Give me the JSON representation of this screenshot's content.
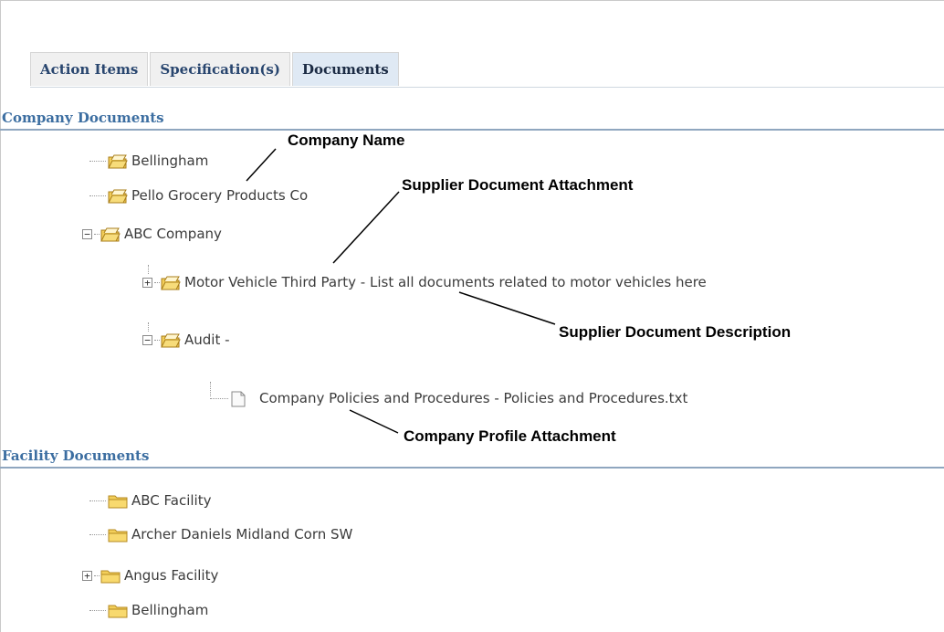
{
  "tabs": [
    {
      "label": "Action Items",
      "active": false
    },
    {
      "label": "Specification(s)",
      "active": false
    },
    {
      "label": "Documents",
      "active": true
    }
  ],
  "company_documents": {
    "header": "Company Documents",
    "items": [
      {
        "label": "Bellingham",
        "icon": "open-folder-icon"
      },
      {
        "label": "Pello Grocery Products Co",
        "icon": "open-folder-icon"
      },
      {
        "label": "ABC Company",
        "icon": "open-folder-icon",
        "expanded": true
      },
      {
        "label": "Motor Vehicle Third Party - List all documents related to motor vehicles here",
        "icon": "open-folder-icon",
        "expanded": false
      },
      {
        "label": "Audit -",
        "icon": "open-folder-icon",
        "expanded": true
      },
      {
        "label": "Company Policies and Procedures - Policies and Procedures.txt",
        "icon": "document-icon"
      }
    ]
  },
  "facility_documents": {
    "header": "Facility Documents",
    "items": [
      {
        "label": "ABC Facility",
        "icon": "folder-icon"
      },
      {
        "label": "Archer Daniels Midland Corn SW",
        "icon": "folder-icon"
      },
      {
        "label": "Angus Facility",
        "icon": "folder-icon",
        "expanded": false
      },
      {
        "label": "Bellingham",
        "icon": "folder-icon"
      }
    ]
  },
  "annotations": {
    "company_name": "Company Name",
    "supplier_doc_attachment": "Supplier Document Attachment",
    "supplier_doc_description": "Supplier Document Description",
    "company_profile_attachment": "Company Profile Attachment"
  },
  "colors": {
    "section_header": "#3c6ea1",
    "tab_text": "#29466f",
    "active_tab_bg": "#dfe9f4",
    "folder_yellow": "#f3cf5a"
  }
}
